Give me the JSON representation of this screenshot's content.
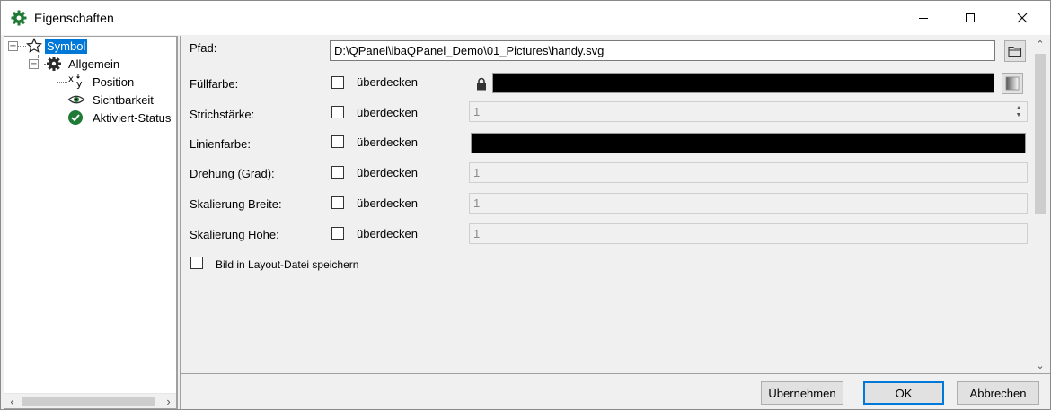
{
  "window": {
    "title": "Eigenschaften"
  },
  "tree": {
    "root": {
      "label": "Symbol",
      "icon": "star-icon"
    },
    "group": {
      "label": "Allgemein",
      "icon": "gear-icon"
    },
    "items": [
      {
        "label": "Position",
        "icon": "xy-position-icon"
      },
      {
        "label": "Sichtbarkeit",
        "icon": "eye-icon"
      },
      {
        "label": "Aktiviert-Status",
        "icon": "check-circle-icon"
      }
    ]
  },
  "properties": {
    "path": {
      "label": "Pfad:",
      "value": "D:\\QPanel\\ibaQPanel_Demo\\01_Pictures\\handy.svg"
    },
    "fill": {
      "label": "Füllfarbe:",
      "override": "überdecken",
      "color": "#000000"
    },
    "stroke_width": {
      "label": "Strichstärke:",
      "override": "überdecken",
      "value": "1"
    },
    "line_color": {
      "label": "Linienfarbe:",
      "override": "überdecken",
      "color": "#000000"
    },
    "rotation": {
      "label": "Drehung (Grad):",
      "override": "überdecken",
      "value": "1"
    },
    "scale_width": {
      "label": "Skalierung Breite:",
      "override": "überdecken",
      "value": "1"
    },
    "scale_height": {
      "label": "Skalierung Höhe:",
      "override": "überdecken",
      "value": "1"
    },
    "save_in_layout": {
      "label": "Bild in Layout-Datei speichern"
    }
  },
  "buttons": {
    "apply": "Übernehmen",
    "ok": "OK",
    "cancel": "Abbrechen"
  },
  "colors": {
    "selection": "#0078d7",
    "accent_green": "#1e7a34"
  }
}
